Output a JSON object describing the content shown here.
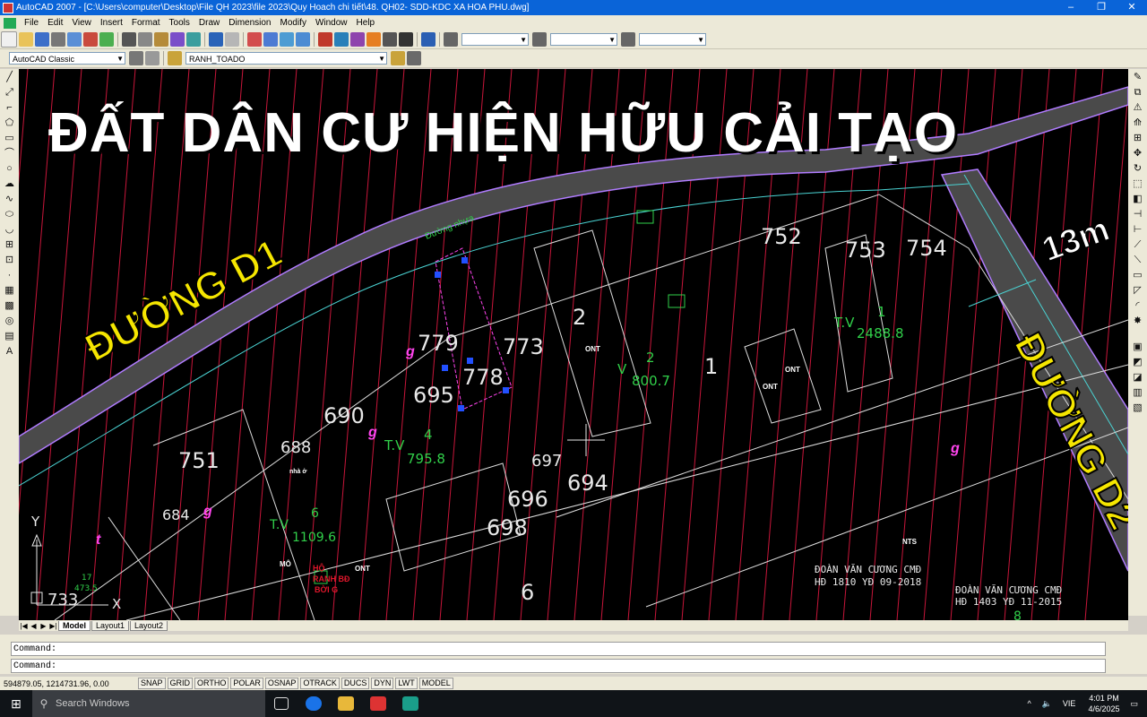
{
  "window": {
    "title": "AutoCAD 2007 - [C:\\Users\\computer\\Desktop\\File QH 2023\\file 2023\\Quy Hoach chi tiết\\48. QH02- SDD-KDC XA HOA PHU.dwg]",
    "minimize": "–",
    "restore": "❐",
    "close": "✕"
  },
  "menu": [
    "File",
    "Edit",
    "View",
    "Insert",
    "Format",
    "Tools",
    "Draw",
    "Dimension",
    "Modify",
    "Window",
    "Help"
  ],
  "toolbar": {
    "workspace": "AutoCAD Classic",
    "layer": "RANH_TOADO"
  },
  "overlay": {
    "title": "ĐẤT DÂN CƯ HIỆN HỮU CẢI TẠO",
    "road_d1": "ĐƯỜNG D1",
    "road_d2": "ĐƯỜNG D2",
    "width": "13m"
  },
  "drawing": {
    "road_label": "Đường nhựa",
    "parcel_numbers": [
      "752",
      "753",
      "754",
      "2",
      "1",
      "779",
      "773",
      "778",
      "695",
      "690",
      "688",
      "751",
      "697",
      "694",
      "696",
      "698",
      "684",
      "6",
      "733"
    ],
    "labels": {
      "ont": "ONT",
      "nts": "NTS",
      "nha_o": "nhà ở",
      "mo": "MÔ",
      "g": "g",
      "t": "t",
      "tv4": "T.V",
      "tv4_num": "4",
      "tv4_area": "795.8",
      "v2": "V",
      "v2_num": "2",
      "v2_area": "800.7",
      "tv1": "T.V",
      "tv1_num": "1",
      "tv1_area": "2488.8",
      "tv6": "T.V",
      "tv6_num": "6",
      "tv6_area": "1109.6",
      "tv17": "17",
      "tv17_area": "473.5",
      "owner1": "ĐOÀN VĂN CƯƠNG CMĐ",
      "owner1_doc": "HĐ 1810 YĐ 09-2018",
      "owner2": "ĐOÀN VĂN CƯƠNG CMĐ",
      "owner2_doc": "HĐ 1403 YĐ 11-2015",
      "ho_ranh": "HỘ",
      "ranh_bd": "RANH BĐ",
      "boi_g": "BỜI G",
      "axis_y": "Y",
      "axis_x": "X",
      "eight": "8"
    }
  },
  "layout_tabs": [
    "Model",
    "Layout1",
    "Layout2"
  ],
  "command": {
    "line1": "Command:",
    "line2": "Command:"
  },
  "status": {
    "coords": "594879.05, 1214731.96, 0.00",
    "toggles": [
      "SNAP",
      "GRID",
      "ORTHO",
      "POLAR",
      "OSNAP",
      "OTRACK",
      "DUCS",
      "DYN",
      "LWT",
      "MODEL"
    ]
  },
  "taskbar": {
    "search": "Search Windows",
    "lang": "VIE",
    "time": "4:01 PM",
    "date": "4/6/2025"
  },
  "colors": {
    "title_bar": "#0a64d8",
    "background": "#000000",
    "road": "#4a4a4a",
    "overlay_text": "#ffffff",
    "road_text": "#f5e600",
    "parcel_green": "#31d04a",
    "parcel_red": "#e0162b"
  }
}
